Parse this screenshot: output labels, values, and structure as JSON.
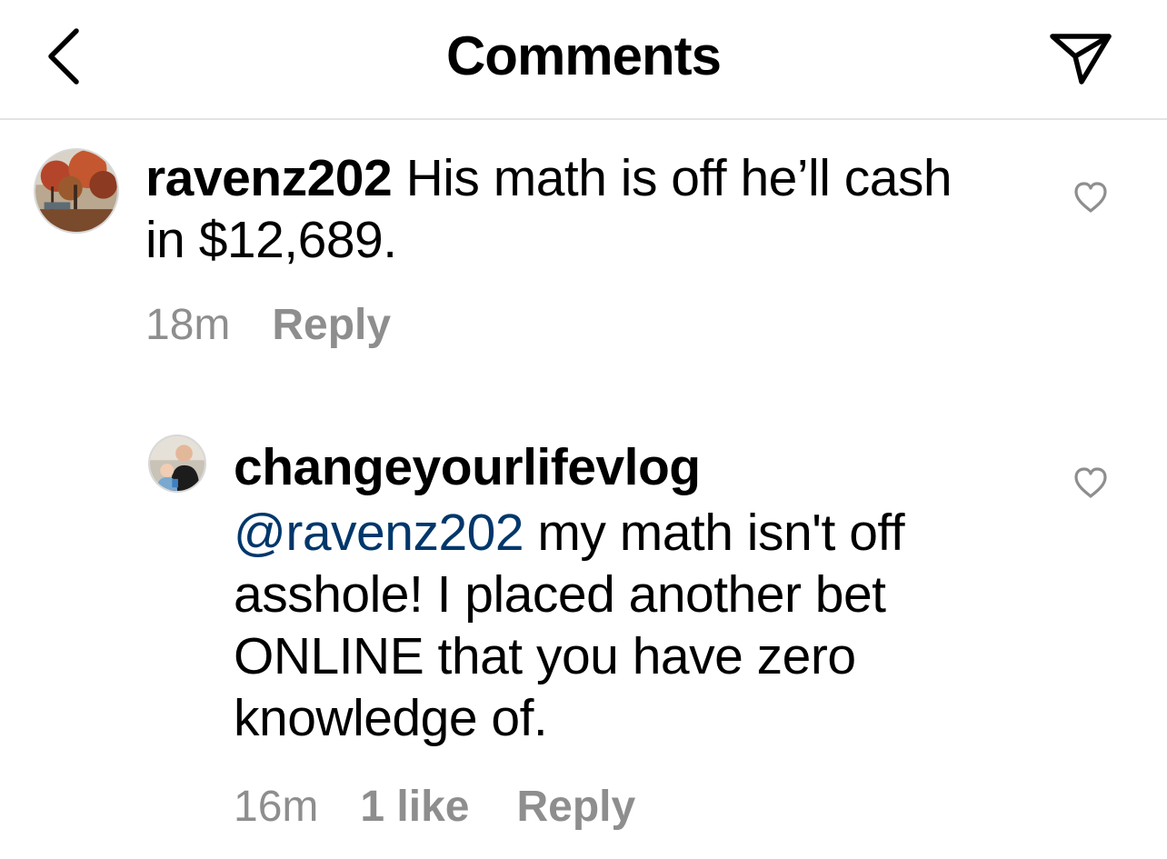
{
  "header": {
    "title": "Comments",
    "back_icon": "chevron-left-icon",
    "send_icon": "paper-plane-icon"
  },
  "comments": [
    {
      "username": "ravenz202",
      "text": "His math is off he’ll cash in $12,689.",
      "time": "18m",
      "reply_label": "Reply",
      "like_icon": "heart-outline-icon"
    },
    {
      "username": "changeyourlifevlog",
      "mention": "@ravenz202",
      "text": "my math isn't off asshole! I placed another bet ONLINE that you have zero knowledge of.",
      "time": "16m",
      "likes": "1 like",
      "reply_label": "Reply",
      "like_icon": "heart-outline-icon"
    }
  ],
  "colors": {
    "text": "#000000",
    "secondary": "#8e8e8e",
    "mention": "#00376b",
    "divider": "#e3e3e3"
  }
}
